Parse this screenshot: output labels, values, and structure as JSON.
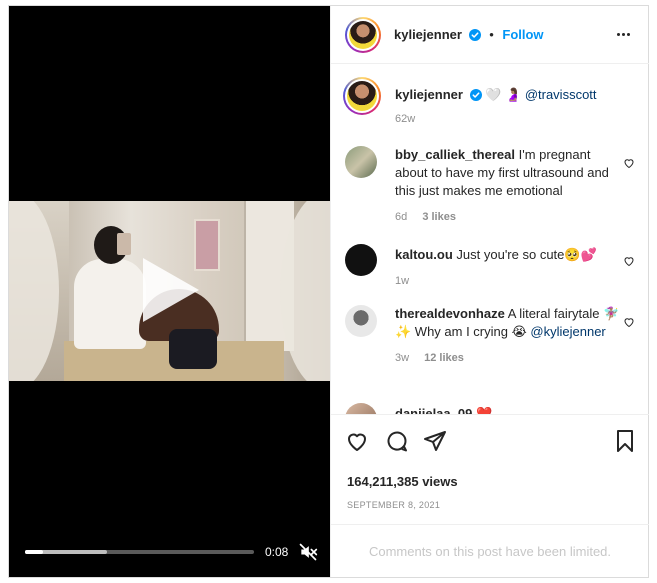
{
  "video": {
    "time": "0:08",
    "progress": 0.08,
    "buffered": 0.36
  },
  "header": {
    "username": "kyliejenner",
    "separator": "•",
    "follow_label": "Follow"
  },
  "caption": {
    "username": "kyliejenner",
    "emoji": "🤍 🤰🏽",
    "mention": "@travisscott",
    "age": "62w"
  },
  "comments": [
    {
      "username": "bby_calliek_thereal",
      "text": "I'm pregnant about to have my first ultrasound and this just makes me emotional",
      "age": "6d",
      "likes": "3 likes"
    },
    {
      "username": "kaltou.ou",
      "text": "Just you're so cute🥺💕",
      "age": "1w",
      "likes": ""
    },
    {
      "username": "therealdevonhaze",
      "text": "A literal fairytale 🧚🏽‍♀️ ✨ Why am I crying 😭",
      "mention": "@kyliejenner",
      "age": "3w",
      "likes": "12 likes"
    },
    {
      "username": "danijelaa_09",
      "text": "❤️",
      "age": "",
      "likes": ""
    }
  ],
  "stats": {
    "views": "164,211,385 views",
    "date": "SEPTEMBER 8, 2021"
  },
  "footer": {
    "limited_text": "Comments on this post have been limited."
  },
  "colors": {
    "accent": "#0095f6",
    "text": "#262626",
    "muted": "#8e8e8e",
    "border": "#dbdbdb"
  },
  "icons": [
    "play-icon",
    "mute-icon",
    "verified-icon",
    "more-icon",
    "heart-icon",
    "comment-icon",
    "share-icon",
    "bookmark-icon"
  ]
}
